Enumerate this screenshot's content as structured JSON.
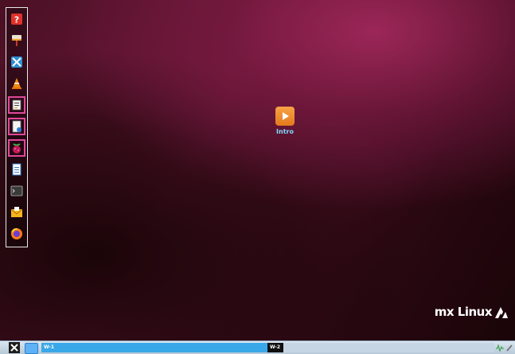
{
  "desktop": {
    "icon_label": "Intro",
    "brand_text": "mx Linux"
  },
  "dock": {
    "items": [
      {
        "name": "help-icon",
        "highlighted": false
      },
      {
        "name": "paint-roller-icon",
        "highlighted": false
      },
      {
        "name": "mx-tools-icon",
        "highlighted": false
      },
      {
        "name": "vlc-cone-icon",
        "highlighted": false
      },
      {
        "name": "file-manager-icon",
        "highlighted": true
      },
      {
        "name": "document-viewer-icon",
        "highlighted": true
      },
      {
        "name": "raspberry-icon",
        "highlighted": true
      },
      {
        "name": "text-document-icon",
        "highlighted": false
      },
      {
        "name": "terminal-icon",
        "highlighted": false
      },
      {
        "name": "mail-icon",
        "highlighted": false
      },
      {
        "name": "firefox-icon",
        "highlighted": false
      }
    ]
  },
  "panel": {
    "workspace_1": "W-1",
    "workspace_2": "W-2"
  },
  "colors": {
    "highlight": "#e0489a",
    "workspace_active": "#3aa8e8",
    "desktop_label": "#7fd9ff"
  }
}
